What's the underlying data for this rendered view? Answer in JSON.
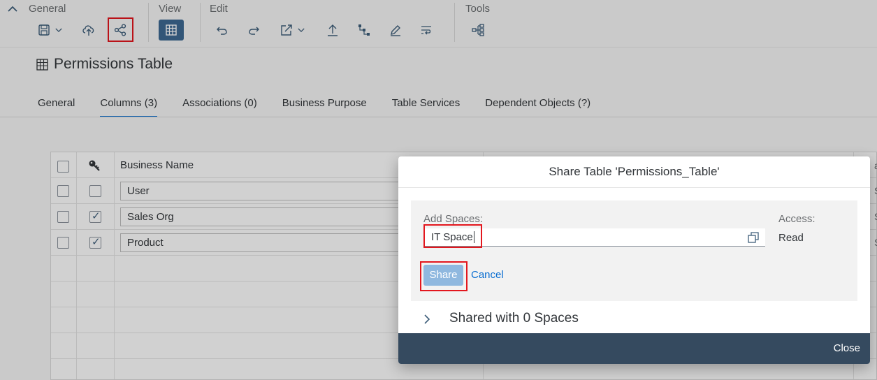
{
  "toolbar": {
    "groups": {
      "general": "General",
      "view": "View",
      "edit": "Edit",
      "tools": "Tools"
    }
  },
  "page": {
    "title": "Permissions Table"
  },
  "tabs": [
    {
      "label": "General"
    },
    {
      "label": "Columns (3)"
    },
    {
      "label": "Associations (0)"
    },
    {
      "label": "Business Purpose"
    },
    {
      "label": "Table Services"
    },
    {
      "label": "Dependent Objects (?)"
    }
  ],
  "table": {
    "header": {
      "business_name": "Business Name"
    },
    "rows": [
      {
        "business_name": "User",
        "key": false
      },
      {
        "business_name": "Sales Org",
        "key": true
      },
      {
        "business_name": "Product",
        "key": true
      }
    ],
    "right_col_partial": [
      "at",
      "St",
      "St",
      "St"
    ]
  },
  "dialog": {
    "title": "Share Table 'Permissions_Table'",
    "add_spaces_label": "Add Spaces:",
    "add_spaces_value": "IT Space",
    "access_label": "Access:",
    "access_value": "Read",
    "share_button": "Share",
    "cancel_button": "Cancel",
    "shared_with": "Shared with 0 Spaces",
    "close_button": "Close"
  },
  "colors": {
    "accent": "#0a6ed1",
    "footer": "#354a5f",
    "highlight": "#e3171e"
  }
}
